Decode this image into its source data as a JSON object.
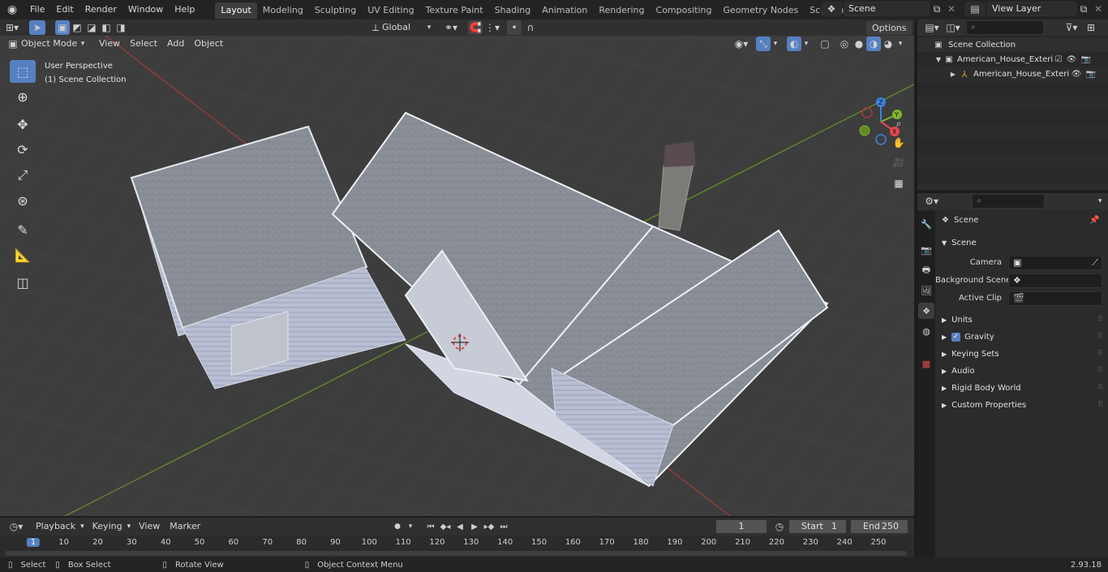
{
  "topbar": {
    "menus": [
      "File",
      "Edit",
      "Render",
      "Window",
      "Help"
    ],
    "workspaces": [
      "Layout",
      "Modeling",
      "Sculpting",
      "UV Editing",
      "Texture Paint",
      "Shading",
      "Animation",
      "Rendering",
      "Compositing",
      "Geometry Nodes",
      "Scripting"
    ],
    "active_workspace": "Layout",
    "add_tab": "+",
    "scene_name": "Scene",
    "view_layer": "View Layer"
  },
  "viewport": {
    "mode": "Object Mode",
    "menus": [
      "View",
      "Select",
      "Add",
      "Object"
    ],
    "orientation": "Global",
    "options": "Options",
    "overlay_title": "User Perspective",
    "overlay_collection": "(1) Scene Collection",
    "gizmo_axes": {
      "x": "X",
      "y": "Y",
      "z": "Z"
    }
  },
  "outliner": {
    "root": "Scene Collection",
    "items": [
      {
        "label": "American_House_Exterior_wit"
      },
      {
        "label": "American_House_Exterio"
      }
    ]
  },
  "properties": {
    "context": "Scene",
    "panel_title": "Scene",
    "camera_label": "Camera",
    "background_label": "Background Scene",
    "active_clip_label": "Active Clip",
    "subpanels": [
      "Units",
      "Gravity",
      "Keying Sets",
      "Audio",
      "Rigid Body World",
      "Custom Properties"
    ]
  },
  "timeline": {
    "menus": [
      "Playback",
      "Keying",
      "View",
      "Marker"
    ],
    "current_frame": "1",
    "start_label": "Start",
    "start": "1",
    "end_label": "End",
    "end": "250",
    "ruler": [
      "1",
      "10",
      "20",
      "30",
      "40",
      "50",
      "60",
      "70",
      "80",
      "90",
      "100",
      "110",
      "120",
      "130",
      "140",
      "150",
      "160",
      "170",
      "180",
      "190",
      "200",
      "210",
      "220",
      "230",
      "240",
      "250"
    ]
  },
  "statusbar": {
    "select": "Select",
    "box_select": "Box Select",
    "rotate_view": "Rotate View",
    "context_menu": "Object Context Menu",
    "version": "2.93.18"
  },
  "colors": {
    "accent": "#5680c2",
    "axis_x": "#e8484c",
    "axis_y": "#7fb62a",
    "axis_z": "#3d83e0"
  }
}
